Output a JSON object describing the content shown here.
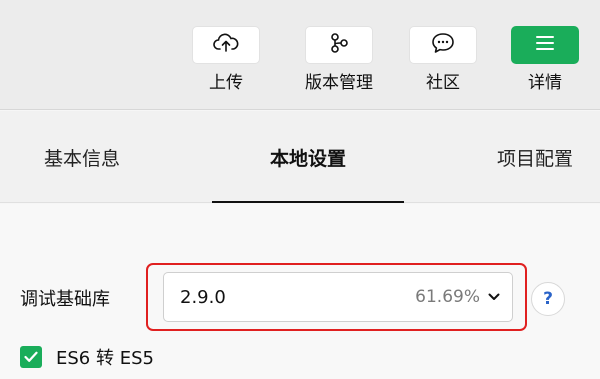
{
  "toolbar": {
    "upload": {
      "label": "上传",
      "icon": "cloud-upload-icon"
    },
    "version": {
      "label": "版本管理",
      "icon": "branch-icon"
    },
    "community": {
      "label": "社区",
      "icon": "chat-bubble-icon"
    },
    "details": {
      "label": "详情",
      "icon": "menu-icon"
    }
  },
  "tabs": [
    {
      "label": "基本信息",
      "active": false
    },
    {
      "label": "本地设置",
      "active": true
    },
    {
      "label": "项目配置",
      "active": false
    }
  ],
  "settings": {
    "base_library": {
      "label": "调试基础库",
      "value": "2.9.0",
      "percent": "61.69%",
      "help": "?"
    },
    "es6_to_es5": {
      "label": "ES6 转 ES5",
      "checked": true
    }
  },
  "colors": {
    "accent_green": "#1aad5a",
    "highlight_red": "#e02020",
    "help_blue": "#2a63c8"
  }
}
